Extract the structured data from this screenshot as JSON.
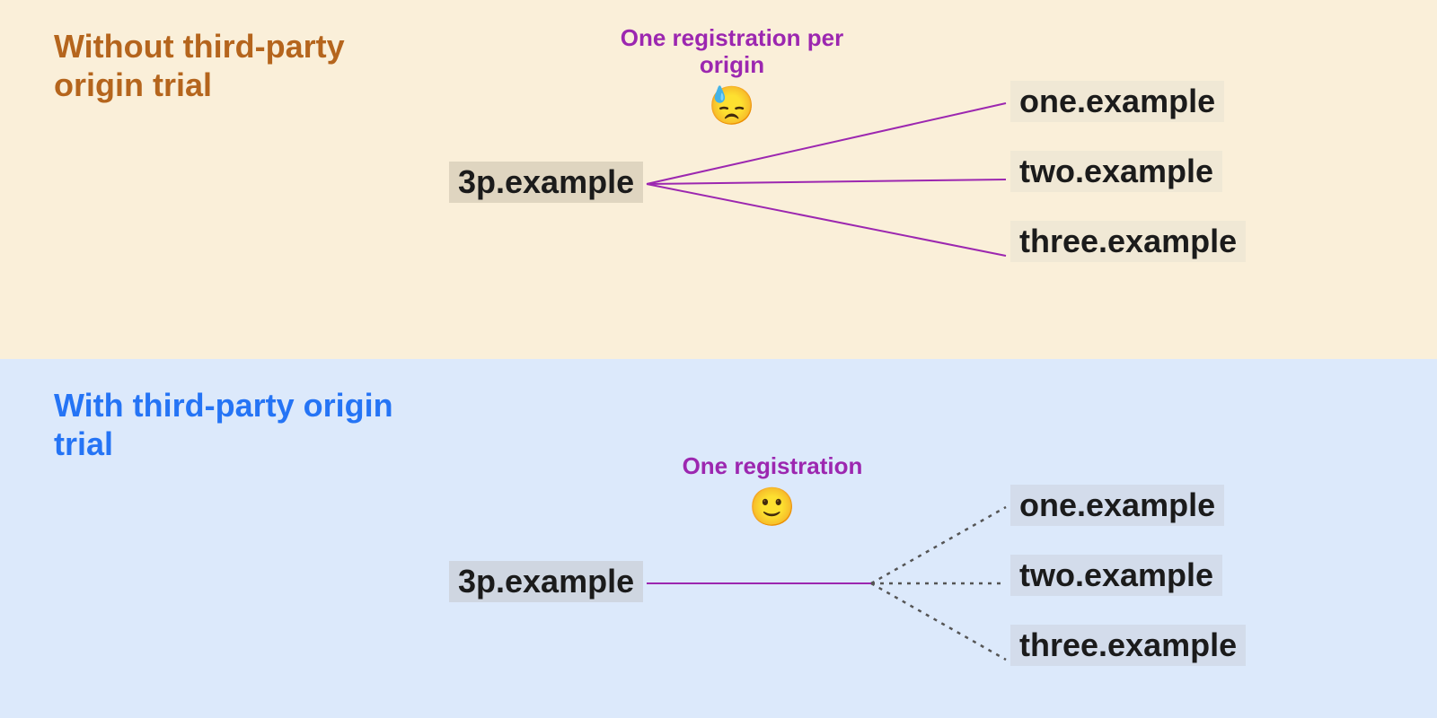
{
  "top": {
    "title": "Without third-party origin trial",
    "source": "3p.example",
    "caption": "One registration per origin",
    "emoji": "😓",
    "targets": [
      "one.example",
      "two.example",
      "three.example"
    ],
    "connector_color": "#9C27B0",
    "connector_style": "solid-fanout"
  },
  "bottom": {
    "title": "With third-party origin trial",
    "source": "3p.example",
    "caption": "One registration",
    "emoji": "🙂",
    "targets": [
      "one.example",
      "two.example",
      "three.example"
    ],
    "connector_color": "#9C27B0",
    "connector_secondary_color": "#555555",
    "connector_style": "single-then-dotted-fanout"
  }
}
